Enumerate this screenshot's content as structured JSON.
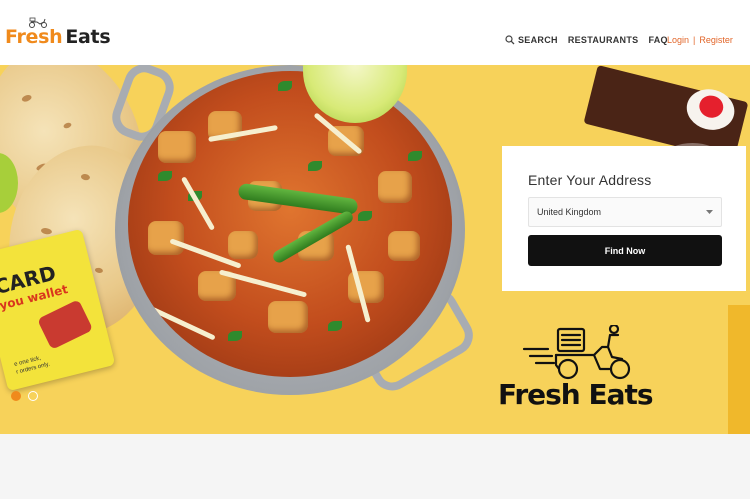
{
  "header": {
    "logo": {
      "fresh": "Fresh",
      "eats": "Eats"
    },
    "nav": [
      {
        "label": "SEARCH",
        "icon": "search-icon"
      },
      {
        "label": "RESTAURANTS"
      },
      {
        "label": "FAQ"
      }
    ],
    "auth": {
      "login": "Login",
      "separator": "|",
      "register": "Register"
    }
  },
  "hero": {
    "promo_card": {
      "title": "CARD",
      "subtitle": "you wallet",
      "note": "e one tick,\nr orders only."
    },
    "slider_dots": {
      "count": 2,
      "active_index": 0
    }
  },
  "address": {
    "title": "Enter Your Address",
    "selected_country": "United Kingdom",
    "button_label": "Find Now"
  },
  "brand": {
    "text": "Fresh Eats"
  },
  "colors": {
    "brand_orange": "#f08a1c",
    "hero_yellow": "#f7d25a",
    "button_black": "#111111",
    "link_orange": "#e2662a"
  }
}
